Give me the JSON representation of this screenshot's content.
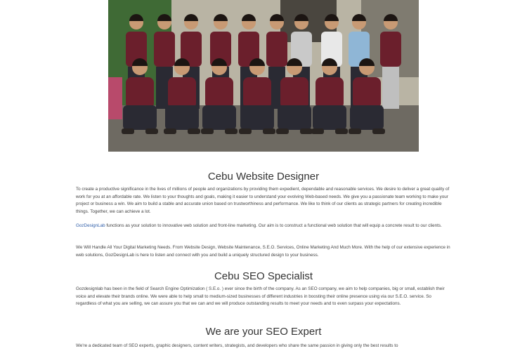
{
  "photo": {
    "alt": "",
    "colors": {
      "background": "#8a8578",
      "foliage": "#3f6a35",
      "wall": "#b9b4a4",
      "shirt": "#6b1f2c",
      "skin": "#c89a74",
      "hair": "#1c1512",
      "pants": "#2a2a33",
      "floor": "#6e6a62"
    }
  },
  "sections": [
    {
      "heading": "Cebu Website Designer",
      "paragraphs": [
        {
          "text": "To create a productive significance in the lives of millions of people and organizations by providing them expedient, dependable and reasonable services. We desire to deliver a great quality of work for you at an affordable rate. We listen to your thoughts and goals, making it easier to understand your evolving Web-based needs. We give you a passionate team working to make your project or business a win. We aim to build a stable and accurate union based on trustworthiness and performance. We like to think of our clients as strategic partners for creating incredible things. Together, we can achieve a lot."
        },
        {
          "link": "GozDesignLab",
          "text": " functions as your solution to innovative web solution and front-line marketing. Our aim is to construct a functional web solution that will equip a concrete result to our clients."
        },
        {
          "text": "We Will Handle All Your Digital Marketing Needs. From Website Design, Website Maintenance, S.E.O. Services, Online Marketing And Much More. With the help of our extensive experience in web solutions, GozDesignLab is here to listen and connect with you and build a uniquely structured design to your business."
        }
      ]
    },
    {
      "heading": "Cebu SEO Specialist",
      "paragraphs": [
        {
          "text": "Gozdesignlab has been in the field of Search Engine Optimization ( S.E.o. ) ever since the birth of the company. As an SEO company, we aim to help companies, big or small, establish their voice and elevate their brands online. We were able to help small to medium-sized businesses of different industries in boosting their online presence using via our S.E.O. service. So regardless of what you are selling, we can assure you that we can and we will produce outstanding results to meet your needs and to even surpass your expectations."
        }
      ]
    },
    {
      "heading": "We are your SEO Expert",
      "paragraphs": [
        {
          "text": "We're a dedicated team of SEO experts, graphic designers, content writers, strategists, and developers who share the same passion in giving only the best results to"
        }
      ]
    }
  ]
}
